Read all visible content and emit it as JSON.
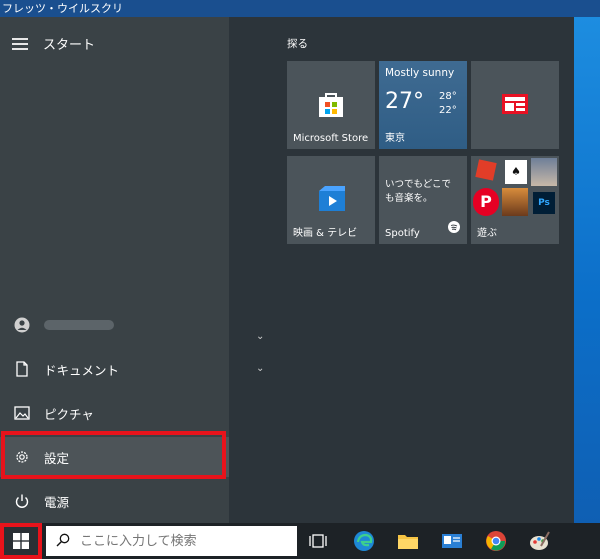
{
  "window": {
    "title": "フレッツ・ウイルスクリ"
  },
  "start_menu": {
    "header_label": "スタート",
    "left_nav": {
      "user": {
        "name_blurred": true
      },
      "items": [
        {
          "label": "ドキュメント",
          "icon": "document-icon"
        },
        {
          "label": "ピクチャ",
          "icon": "pictures-icon"
        },
        {
          "label": "設定",
          "icon": "gear-icon",
          "selected": true
        },
        {
          "label": "電源",
          "icon": "power-icon"
        }
      ]
    },
    "tile_group_title": "探る",
    "tiles": [
      {
        "label": "Microsoft Store",
        "icon": "store-icon"
      },
      {
        "condition": "Mostly sunny",
        "temp": "27°",
        "high": "28°",
        "low": "22°",
        "city": "東京"
      },
      {
        "label": "",
        "icon": "news-icon"
      },
      {
        "label": "映画 & テレビ",
        "icon": "movies-tv-icon"
      },
      {
        "label": "Spotify",
        "promo": "いつでもどこでも音楽を。",
        "icon": "spotify-icon"
      },
      {
        "label": "遊ぶ",
        "icon": "games-folder-icon"
      }
    ],
    "highlight_color": "#e8131b"
  },
  "taskbar": {
    "search_placeholder": "ここに入力して検索",
    "icons": [
      "task-view-icon",
      "edge-icon",
      "file-explorer-icon",
      "mail-icon",
      "chrome-icon",
      "paint-icon"
    ]
  }
}
